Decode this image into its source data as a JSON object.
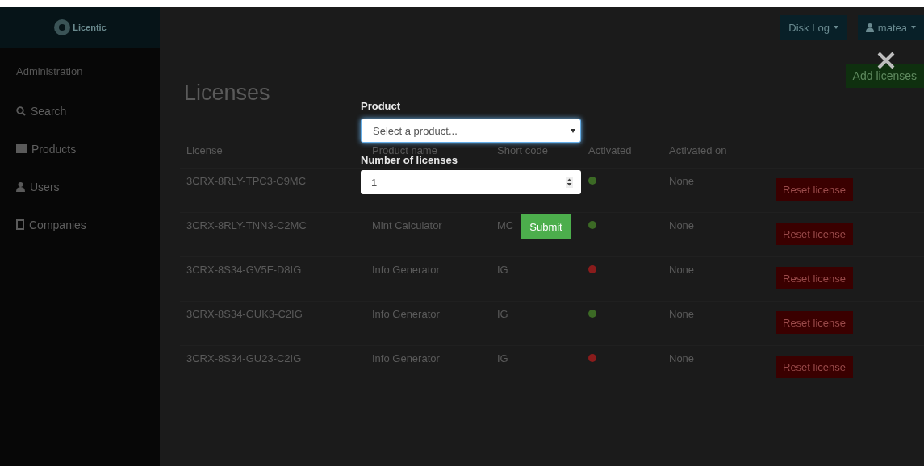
{
  "sidebar": {
    "logo": "Licentic",
    "section": "Administration",
    "items": [
      {
        "label": "Search"
      },
      {
        "label": "Products"
      },
      {
        "label": "Users"
      },
      {
        "label": "Companies"
      }
    ]
  },
  "topbar": {
    "buttons": [
      {
        "label": "Disk Log"
      },
      {
        "label": "matea"
      }
    ]
  },
  "page": {
    "title": "Licenses",
    "add_button": "Add licenses"
  },
  "table": {
    "columns": [
      "License",
      "Product name",
      "Short code",
      "Activated",
      "Activated on"
    ],
    "rows": [
      {
        "license": "3CRX-8RLY-TPC3-C9MC",
        "activated": true,
        "activated_on": "None",
        "action": "Reset license"
      },
      {
        "license": "3CRX-8RLY-TNN3-C2MC",
        "product": "Mint Calculator",
        "short_code": "MC",
        "activated": true,
        "activated_on": "None",
        "action": "Reset license"
      },
      {
        "license": "3CRX-8S34-GV5F-D8IG",
        "product": "Info Generator",
        "short_code": "IG",
        "activated": false,
        "activated_on": "None",
        "action": "Reset license"
      },
      {
        "license": "3CRX-8S34-GUK3-C2IG",
        "product": "Info Generator",
        "short_code": "IG",
        "activated": true,
        "activated_on": "None",
        "action": "Reset license"
      },
      {
        "license": "3CRX-8S34-GU23-C2IG",
        "product": "Info Generator",
        "short_code": "IG",
        "activated": false,
        "activated_on": "None",
        "action": "Reset license"
      }
    ]
  },
  "modal": {
    "product_label": "Product",
    "product_placeholder": "Select a product...",
    "count_label": "Number of licenses",
    "count_value": "1",
    "submit": "Submit"
  }
}
